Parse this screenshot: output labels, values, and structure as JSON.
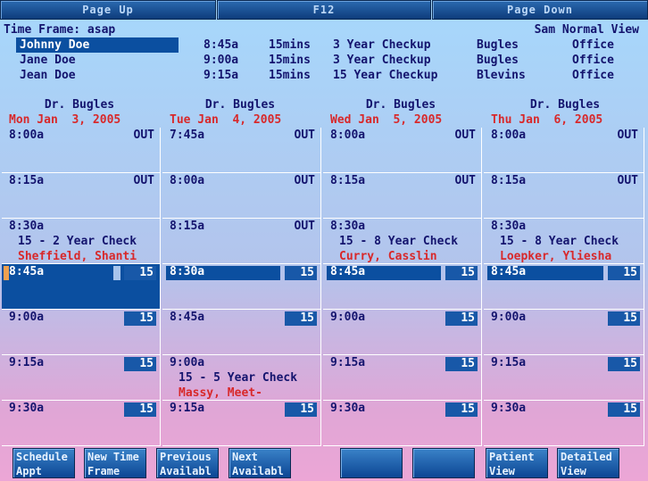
{
  "topbar": {
    "page_up": "Page Up",
    "f12": "F12",
    "page_down": "Page Down"
  },
  "header": {
    "time_frame": "Time Frame: asap",
    "view_name": "Sam Normal View",
    "patients": [
      {
        "name": "Johnny Doe",
        "time": "8:45a",
        "length": "15mins",
        "type": "3 Year Checkup",
        "doctor": "Bugles",
        "location": "Office"
      },
      {
        "name": "Jane Doe",
        "time": "9:00a",
        "length": "15mins",
        "type": "3 Year Checkup",
        "doctor": "Bugles",
        "location": "Office"
      },
      {
        "name": "Jean Doe",
        "time": "9:15a",
        "length": "15mins",
        "type": "15 Year Checkup",
        "doctor": "Blevins",
        "location": "Office"
      }
    ]
  },
  "columns": [
    {
      "doctor": "Dr. Bugles",
      "date": "Mon Jan  3, 2005",
      "cells": [
        {
          "time": "8:00a",
          "status": "OUT"
        },
        {
          "time": "8:15a",
          "status": "OUT"
        },
        {
          "time": "8:30a",
          "appt": "15 - 2 Year Check",
          "patient": "Sheffield, Shanti"
        },
        {
          "time": "8:45a",
          "dur": "15",
          "selected": true
        },
        {
          "time": "9:00a",
          "dur": "15"
        },
        {
          "time": "9:15a",
          "dur": "15"
        },
        {
          "time": "9:30a",
          "dur": "15"
        }
      ]
    },
    {
      "doctor": "Dr. Bugles",
      "date": "Tue Jan  4, 2005",
      "cells": [
        {
          "time": "7:45a",
          "status": "OUT"
        },
        {
          "time": "8:00a",
          "status": "OUT"
        },
        {
          "time": "8:15a",
          "status": "OUT"
        },
        {
          "time": "8:30a",
          "dur": "15",
          "highlight": true
        },
        {
          "time": "8:45a",
          "dur": "15"
        },
        {
          "time": "9:00a",
          "appt": "15 - 5 Year Check",
          "patient": "Massy, Meet-"
        },
        {
          "time": "9:15a",
          "dur": "15"
        }
      ]
    },
    {
      "doctor": "Dr. Bugles",
      "date": "Wed Jan  5, 2005",
      "cells": [
        {
          "time": "8:00a",
          "status": "OUT"
        },
        {
          "time": "8:15a",
          "status": "OUT"
        },
        {
          "time": "8:30a",
          "appt": "15 - 8 Year Check",
          "patient": "Curry, Casslin"
        },
        {
          "time": "8:45a",
          "dur": "15",
          "highlight": true
        },
        {
          "time": "9:00a",
          "dur": "15"
        },
        {
          "time": "9:15a",
          "dur": "15"
        },
        {
          "time": "9:30a",
          "dur": "15"
        }
      ]
    },
    {
      "doctor": "Dr. Bugles",
      "date": "Thu Jan  6, 2005",
      "cells": [
        {
          "time": "8:00a",
          "status": "OUT"
        },
        {
          "time": "8:15a",
          "status": "OUT"
        },
        {
          "time": "8:30a",
          "appt": "15 - 8 Year Check",
          "patient": "Loepker, Yliesha"
        },
        {
          "time": "8:45a",
          "dur": "15",
          "highlight": true
        },
        {
          "time": "9:00a",
          "dur": "15"
        },
        {
          "time": "9:15a",
          "dur": "15"
        },
        {
          "time": "9:30a",
          "dur": "15"
        }
      ]
    }
  ],
  "bottom_buttons": [
    {
      "label": "Schedule\nAppt"
    },
    {
      "label": "New Time\nFrame"
    },
    {
      "label": "Previous\nAvailabl"
    },
    {
      "label": "Next\nAvailabl"
    },
    {
      "label": ""
    },
    {
      "label": ""
    },
    {
      "label": "Patient\nView"
    },
    {
      "label": "Detailed\nView"
    }
  ],
  "colors": {
    "accent": "#0b4fa0",
    "red_text": "#d8282a",
    "text": "#14146e"
  }
}
